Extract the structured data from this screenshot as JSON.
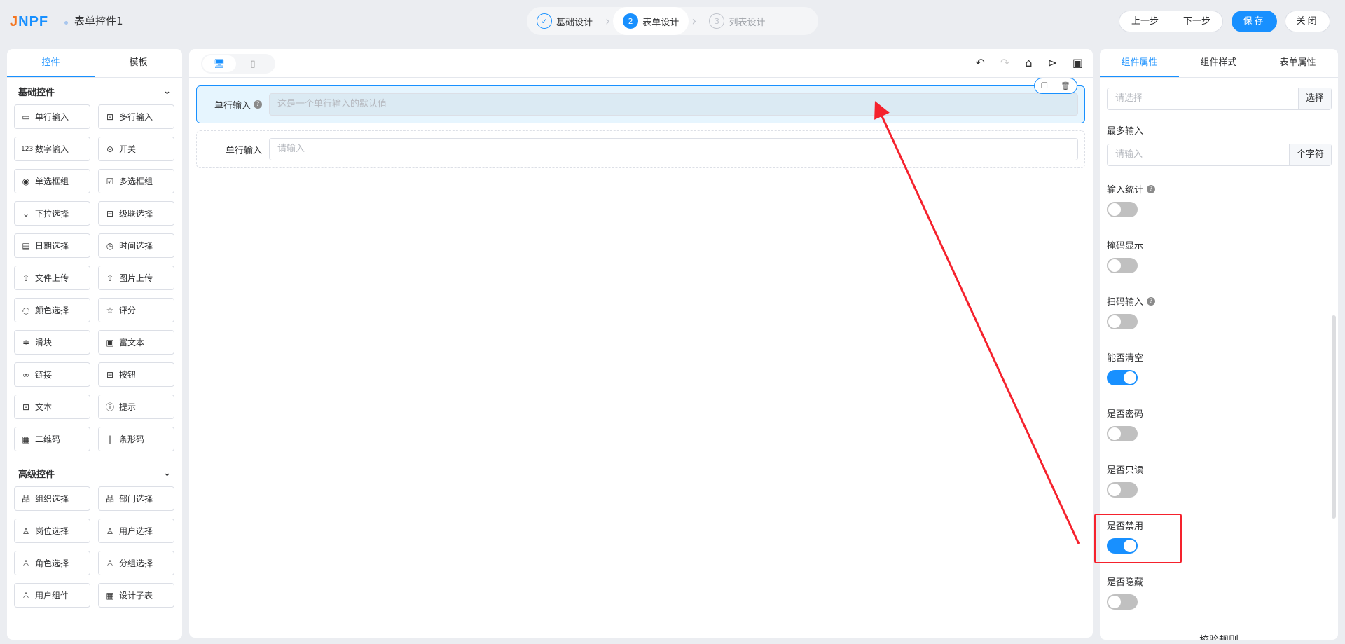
{
  "header": {
    "logo": "JNPF",
    "title": "表单控件1",
    "steps": [
      {
        "num": "✓",
        "label": "基础设计"
      },
      {
        "num": "2",
        "label": "表单设计"
      },
      {
        "num": "3",
        "label": "列表设计"
      }
    ],
    "prev": "上一步",
    "next": "下一步",
    "save": "保存",
    "close": "关闭"
  },
  "left": {
    "tabs": [
      "控件",
      "模板"
    ],
    "basic_title": "基础控件",
    "basic": [
      {
        "i": "▭",
        "l": "单行输入"
      },
      {
        "i": "⊡",
        "l": "多行输入"
      },
      {
        "i": "123",
        "l": "数字输入"
      },
      {
        "i": "⊙",
        "l": "开关"
      },
      {
        "i": "◉",
        "l": "单选框组"
      },
      {
        "i": "☑",
        "l": "多选框组"
      },
      {
        "i": "⌄",
        "l": "下拉选择"
      },
      {
        "i": "⊟",
        "l": "级联选择"
      },
      {
        "i": "▤",
        "l": "日期选择"
      },
      {
        "i": "◷",
        "l": "时间选择"
      },
      {
        "i": "⇧",
        "l": "文件上传"
      },
      {
        "i": "⇧",
        "l": "图片上传"
      },
      {
        "i": "◌",
        "l": "颜色选择"
      },
      {
        "i": "☆",
        "l": "评分"
      },
      {
        "i": "≑",
        "l": "滑块"
      },
      {
        "i": "▣",
        "l": "富文本"
      },
      {
        "i": "∞",
        "l": "链接"
      },
      {
        "i": "⊟",
        "l": "按钮"
      },
      {
        "i": "⊡",
        "l": "文本"
      },
      {
        "i": "ⓘ",
        "l": "提示"
      },
      {
        "i": "▦",
        "l": "二维码"
      },
      {
        "i": "‖",
        "l": "条形码"
      }
    ],
    "adv_title": "高级控件",
    "adv": [
      {
        "i": "品",
        "l": "组织选择"
      },
      {
        "i": "品",
        "l": "部门选择"
      },
      {
        "i": "♙",
        "l": "岗位选择"
      },
      {
        "i": "♙",
        "l": "用户选择"
      },
      {
        "i": "♙",
        "l": "角色选择"
      },
      {
        "i": "♙",
        "l": "分组选择"
      },
      {
        "i": "♙",
        "l": "用户组件"
      },
      {
        "i": "▦",
        "l": "设计子表"
      }
    ]
  },
  "canvas": {
    "items": [
      {
        "label": "单行输入",
        "value": "这是一个单行输入的默认值"
      },
      {
        "label": "单行输入",
        "placeholder": "请输入"
      }
    ]
  },
  "right": {
    "tabs": [
      "组件属性",
      "组件样式",
      "表单属性"
    ],
    "select_placeholder": "请选择",
    "select_btn": "选择",
    "max_label": "最多输入",
    "max_placeholder": "请输入",
    "max_suffix": "个字符",
    "switches": [
      {
        "label": "输入统计",
        "help": true,
        "on": false
      },
      {
        "label": "掩码显示",
        "on": false
      },
      {
        "label": "扫码输入",
        "help": true,
        "on": false
      },
      {
        "label": "能否清空",
        "on": true
      },
      {
        "label": "是否密码",
        "on": false
      },
      {
        "label": "是否只读",
        "on": false
      },
      {
        "label": "是否禁用",
        "on": true
      },
      {
        "label": "是否隐藏",
        "on": false
      }
    ],
    "rules_title": "校验规则"
  },
  "colors": {
    "accent": "#1890ff",
    "annotation": "#f5222d"
  }
}
